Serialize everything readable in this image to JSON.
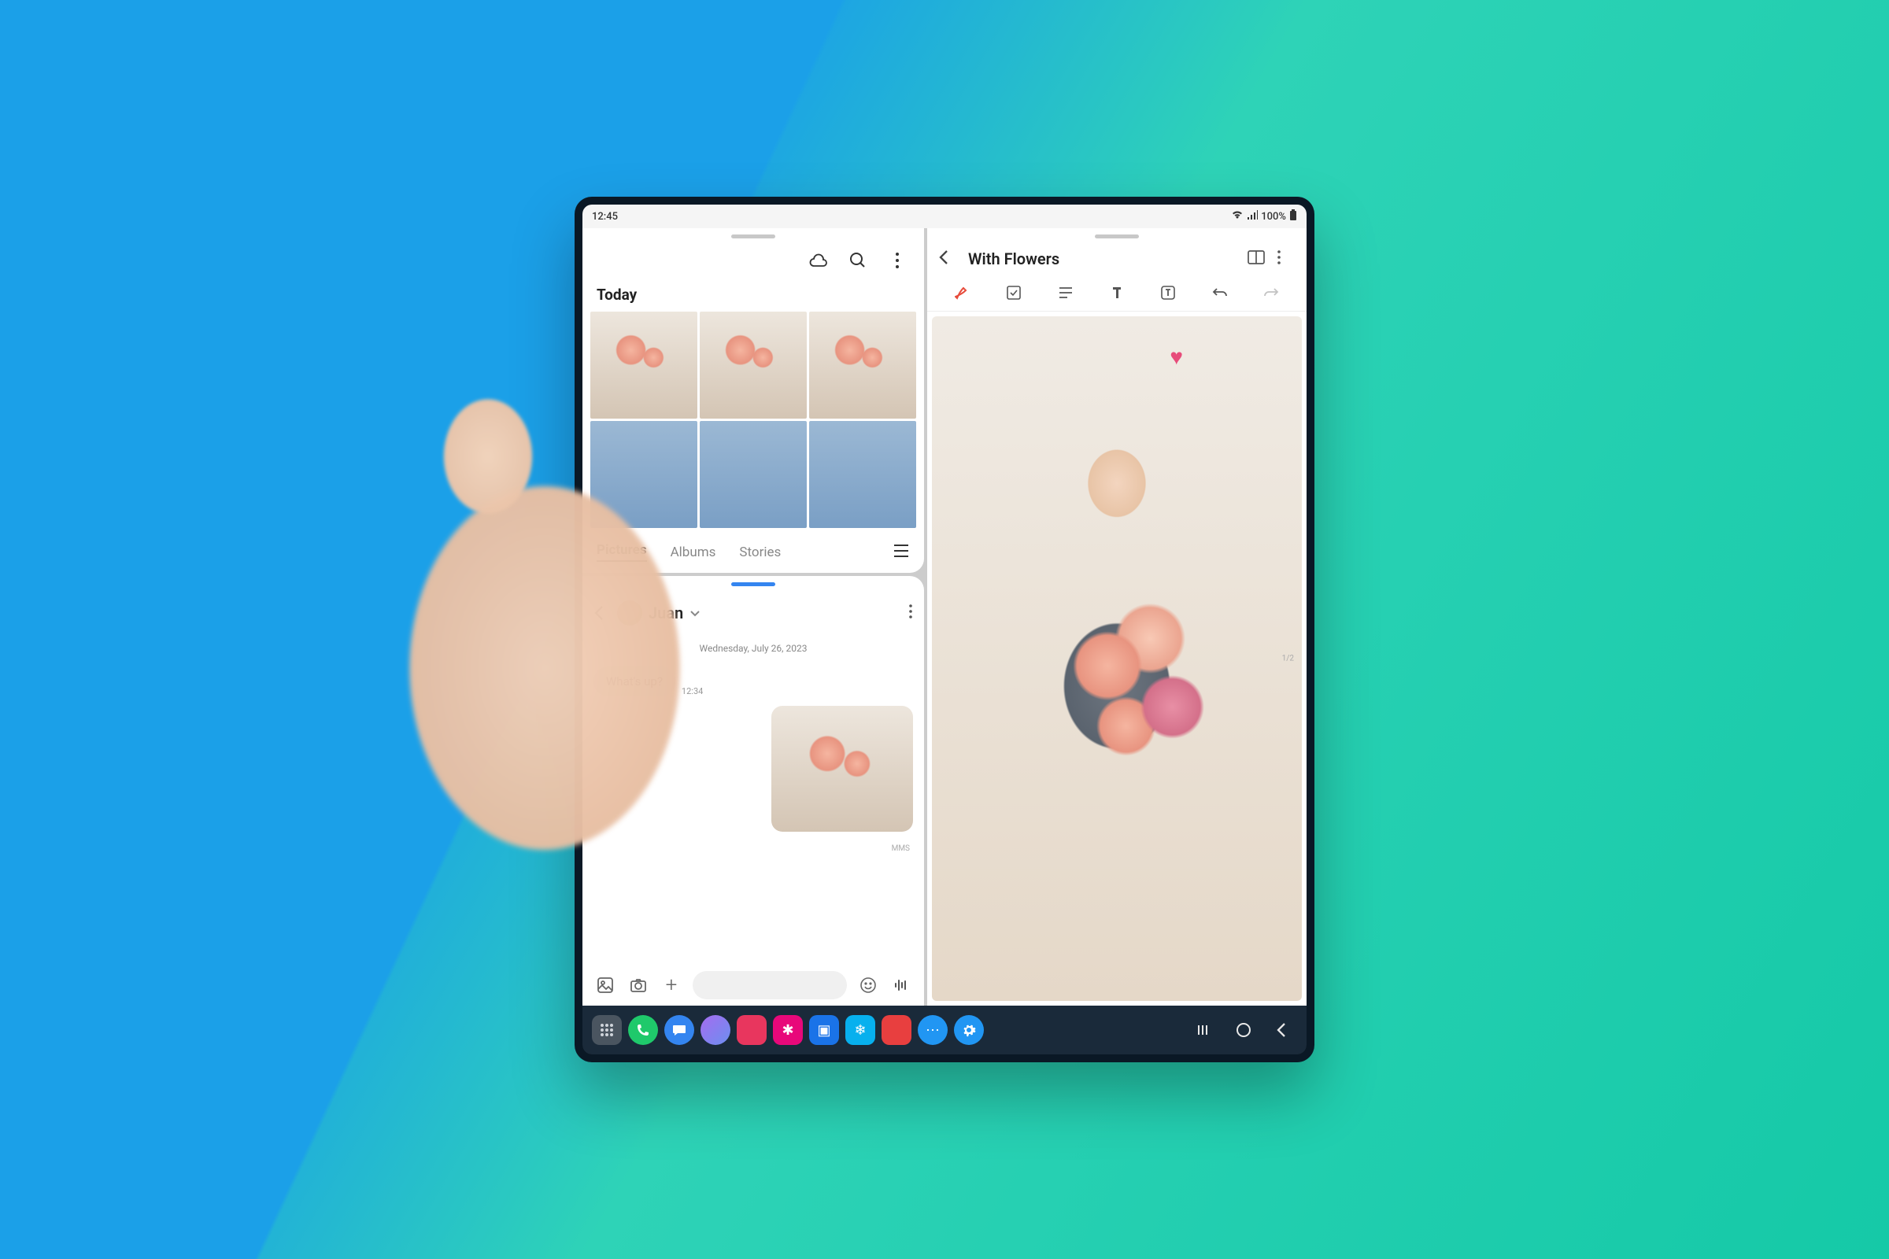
{
  "status": {
    "time": "12:45",
    "battery": "100%"
  },
  "gallery": {
    "section_title": "Today",
    "tabs": {
      "pictures": "Pictures",
      "albums": "Albums",
      "stories": "Stories"
    },
    "icons": {
      "cloud": "cloud-icon",
      "search": "search-icon",
      "more": "more-icon",
      "menu": "menu-icon"
    }
  },
  "messages": {
    "contact": "Juan",
    "date": "Wednesday, July 26, 2023",
    "bubble_text": "What's up?",
    "bubble_time": "12:34",
    "mms_label": "MMS"
  },
  "notes": {
    "title": "With Flowers",
    "page_indicator": "1/2"
  },
  "dock": {
    "colors": {
      "drawer": "#4a5560",
      "phone": "#1fc96b",
      "messages": "#3485f0",
      "bixby": "#a56cf0",
      "app1": "#e8365e",
      "app2": "#e8087a",
      "app3": "#1a73e8",
      "app4": "#07b0ee",
      "app5": "#e83f3f",
      "app6": "#2196f3",
      "settings": "#2196f3"
    }
  }
}
